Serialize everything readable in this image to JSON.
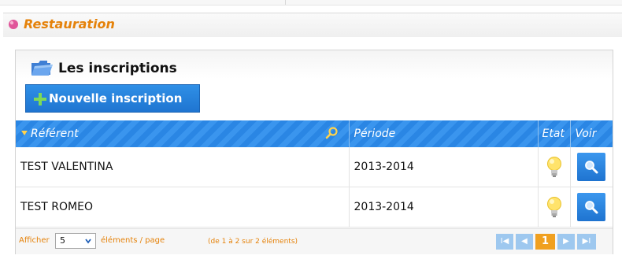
{
  "section": {
    "title": "Restauration"
  },
  "panel": {
    "title": "Les inscriptions",
    "new_button": "Nouvelle inscription"
  },
  "table": {
    "columns": [
      "Référent",
      "Période",
      "Etat",
      "Voir"
    ],
    "rows": [
      {
        "referent": "TEST VALENTINA",
        "periode": "2013-2014",
        "etat_icon": "lightbulb-icon",
        "voir_icon": "magnifier-icon"
      },
      {
        "referent": "TEST ROMEO",
        "periode": "2013-2014",
        "etat_icon": "lightbulb-icon",
        "voir_icon": "magnifier-icon"
      }
    ]
  },
  "pager": {
    "show_label": "Afficher",
    "page_size": "5",
    "items_label": "éléments / page",
    "range_label": "(de 1 à 2 sur 2 éléments)",
    "current_page": "1",
    "first": "I◀",
    "prev": "◀",
    "next": "▶",
    "last": "▶I"
  },
  "colors": {
    "accent": "#e5820a",
    "header_blue": "#2a86e4",
    "button_blue": "#1f75d1",
    "current_page": "#f0a020"
  }
}
